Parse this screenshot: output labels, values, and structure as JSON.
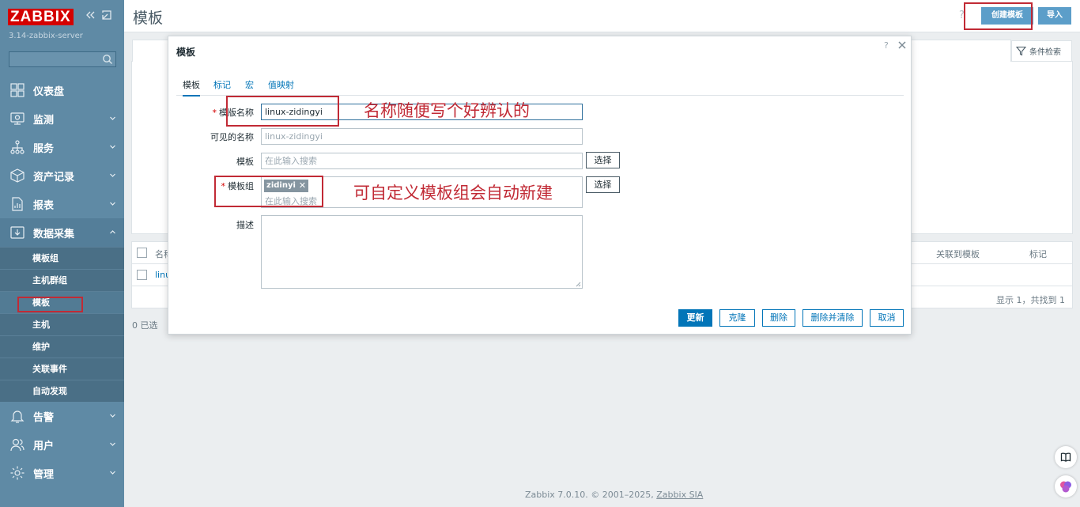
{
  "app": {
    "logo": "ZABBIX",
    "server": "3.14-zabbix-server"
  },
  "sidebar": {
    "menu": [
      {
        "label": "仪表盘",
        "icon": "dashboard-icon"
      },
      {
        "label": "监测",
        "icon": "monitoring-icon"
      },
      {
        "label": "服务",
        "icon": "services-icon"
      },
      {
        "label": "资产记录",
        "icon": "inventory-icon"
      },
      {
        "label": "报表",
        "icon": "reports-icon"
      },
      {
        "label": "数据采集",
        "icon": "data-collection-icon"
      },
      {
        "label": "告警",
        "icon": "alerts-icon"
      },
      {
        "label": "用户",
        "icon": "users-icon"
      },
      {
        "label": "管理",
        "icon": "administration-icon"
      }
    ],
    "submenu": [
      "模板组",
      "主机群组",
      "模板",
      "主机",
      "维护",
      "关联事件",
      "自动发现"
    ]
  },
  "header": {
    "title": "模板",
    "help": "?",
    "create_label": "创建模板",
    "import_label": "导入"
  },
  "filter": {
    "label": "条件检索"
  },
  "table": {
    "columns": {
      "name": "名称",
      "linked": "关联到模板",
      "tags": "标记"
    },
    "rows": [
      {
        "name": "linux-zidingyi"
      }
    ],
    "footer": "显示 1，共找到 1",
    "selected": "0 已选"
  },
  "modal": {
    "title": "模板",
    "help": "?",
    "tabs": [
      "模板",
      "标记",
      "宏",
      "值映射"
    ],
    "fields": {
      "template_name_label": "模版名称",
      "template_name_value": "linux-zidingyi",
      "visible_name_label": "可见的名称",
      "visible_name_placeholder": "linux-zidingyi",
      "templates_label": "模板",
      "templates_placeholder": "在此输入搜索",
      "groups_label": "模板组",
      "group_chip": "zidinyi",
      "groups_placeholder": "在此输入搜索",
      "description_label": "描述"
    },
    "select_label": "选择",
    "buttons": {
      "update": "更新",
      "clone": "克隆",
      "delete": "删除",
      "delete_clear": "删除并清除",
      "cancel": "取消"
    }
  },
  "annotations": {
    "name_note": "名称随便写个好辨认的",
    "group_note": "可自定义模板组会自动新建"
  },
  "footer": {
    "copyright": "Zabbix 7.0.10. © 2001–2025, ",
    "company": "Zabbix SIA"
  },
  "colors": {
    "sidebar": "#5f8aa5",
    "accent": "#0275b8",
    "logo": "#d40000",
    "annotation": "#c12a35"
  }
}
